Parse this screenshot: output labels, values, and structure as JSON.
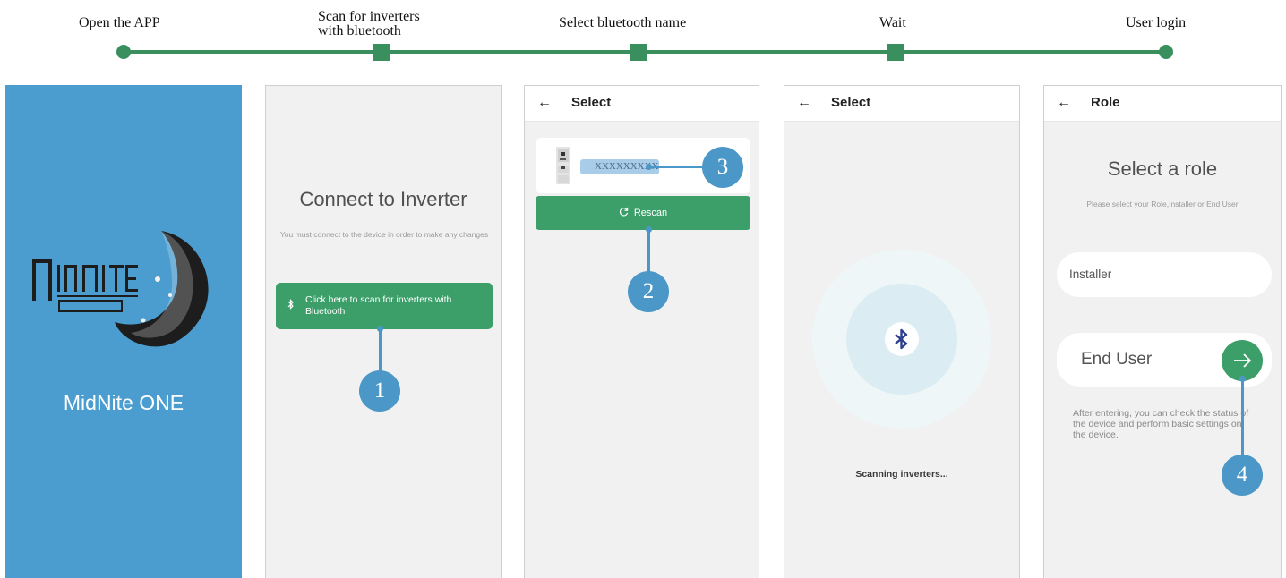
{
  "steps": {
    "open_app": "Open the APP",
    "scan_line1": "Scan for inverters",
    "scan_line2": "with bluetooth",
    "select_name": "Select bluetooth name",
    "wait": "Wait",
    "login": "User login"
  },
  "colors": {
    "green": "#3a8f5e",
    "button_green": "#3c9e68",
    "splash_blue": "#4b9ccf",
    "callout_blue": "#4a97c8"
  },
  "splash": {
    "logo_name": "midnite-solar-logo",
    "app_name": "MidNite ONE"
  },
  "connect": {
    "title": "Connect to Inverter",
    "subtitle": "You must connect to the device in order to make any changes",
    "scan_button": "Click here to scan for inverters with Bluetooth",
    "bluetooth_icon": "bluetooth-icon"
  },
  "select": {
    "back": "←",
    "title": "Select",
    "device_name": "XXXXXXXXX",
    "rescan": "Rescan",
    "rescan_icon": "refresh-icon"
  },
  "wait": {
    "back": "←",
    "title": "Select",
    "scanning": "Scanning inverters..."
  },
  "role": {
    "back": "←",
    "title": "Role",
    "heading": "Select a role",
    "subheading": "Please select your Role,Installer or End User",
    "installer": "Installer",
    "end_user": "End User",
    "go_icon": "arrow-right-icon",
    "note": "After entering, you can check the status of the device and perform basic settings on the device."
  },
  "callouts": {
    "c1": "1",
    "c2": "2",
    "c3": "3",
    "c4": "4"
  }
}
